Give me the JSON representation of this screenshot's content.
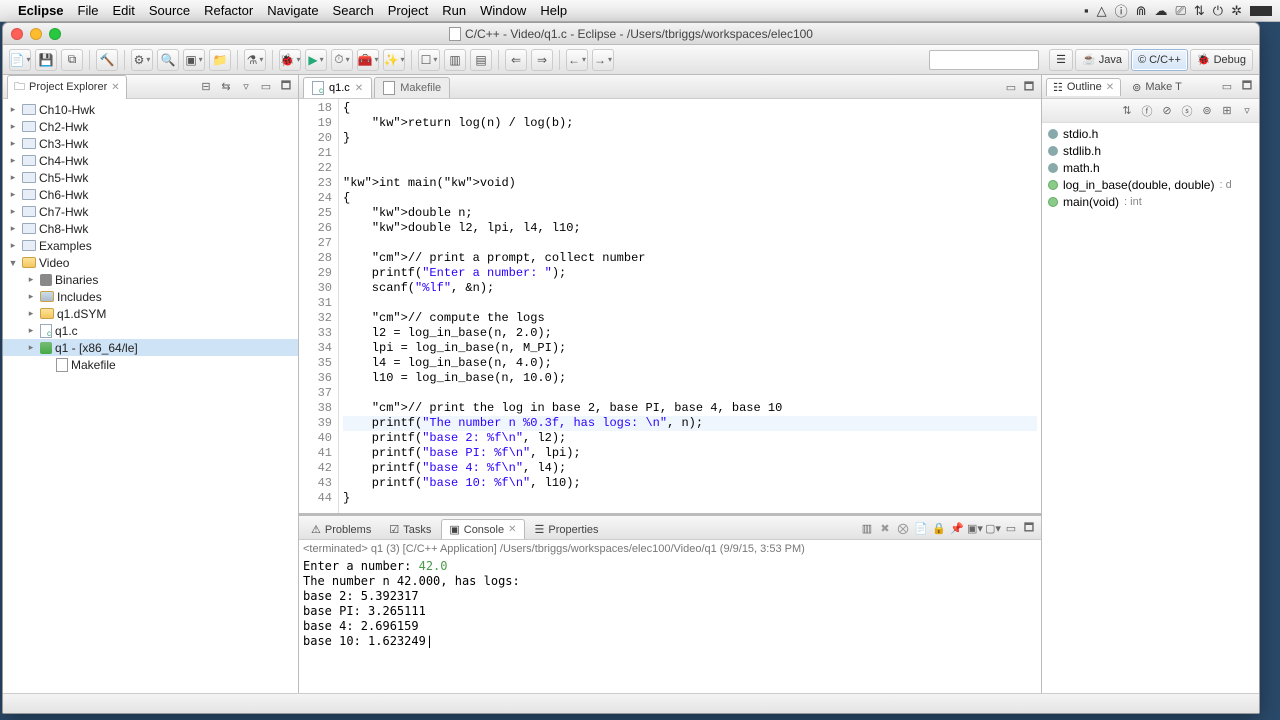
{
  "mac_menu": {
    "app": "Eclipse",
    "items": [
      "File",
      "Edit",
      "Source",
      "Refactor",
      "Navigate",
      "Search",
      "Project",
      "Run",
      "Window",
      "Help"
    ]
  },
  "window": {
    "title": "C/C++ - Video/q1.c - Eclipse - /Users/tbriggs/workspaces/elec100"
  },
  "perspectives": {
    "java": "Java",
    "cpp": "C/C++",
    "debug": "Debug"
  },
  "project_explorer": {
    "title": "Project Explorer",
    "projects": [
      "Ch10-Hwk",
      "Ch2-Hwk",
      "Ch3-Hwk",
      "Ch4-Hwk",
      "Ch5-Hwk",
      "Ch6-Hwk",
      "Ch7-Hwk",
      "Ch8-Hwk",
      "Examples"
    ],
    "open_project": "Video",
    "children": {
      "binaries": "Binaries",
      "includes": "Includes",
      "dsym": "q1.dSYM",
      "src": "q1.c",
      "exe": "q1 - [x86_64/le]",
      "make": "Makefile"
    }
  },
  "editor": {
    "tabs": {
      "active": "q1.c",
      "inactive": "Makefile"
    },
    "gutter_start": 18,
    "lines": [
      "{",
      "    return log(n) / log(b);",
      "}",
      "",
      "",
      "int main(void)",
      "{",
      "    double n;",
      "    double l2, lpi, l4, l10;",
      "",
      "    // print a prompt, collect number",
      "    printf(\"Enter a number: \");",
      "    scanf(\"%lf\", &n);",
      "",
      "    // compute the logs",
      "    l2 = log_in_base(n, 2.0);",
      "    lpi = log_in_base(n, M_PI);",
      "    l4 = log_in_base(n, 4.0);",
      "    l10 = log_in_base(n, 10.0);",
      "",
      "    // print the log in base 2, base PI, base 4, base 10",
      "    printf(\"The number n %0.3f, has logs: \\n\", n);",
      "    printf(\"base 2: %f\\n\", l2);",
      "    printf(\"base PI: %f\\n\", lpi);",
      "    printf(\"base 4: %f\\n\", l4);",
      "    printf(\"base 10: %f\\n\", l10);",
      "}"
    ],
    "highlight_index": 21
  },
  "bottom": {
    "tabs": [
      "Problems",
      "Tasks",
      "Console",
      "Properties"
    ],
    "active": 2,
    "terminated": "<terminated> q1 (3) [C/C++ Application] /Users/tbriggs/workspaces/elec100/Video/q1 (9/9/15, 3:53 PM)",
    "prompt": "Enter a number: ",
    "input": "42.0",
    "out": [
      "The number n 42.000, has logs:",
      "base 2: 5.392317",
      "base PI: 3.265111",
      "base 4: 2.696159",
      "base 10: 1.623249"
    ]
  },
  "outline": {
    "title": "Outline",
    "other_tab": "Make T",
    "items": [
      {
        "kind": "inc",
        "label": "stdio.h"
      },
      {
        "kind": "inc",
        "label": "stdlib.h"
      },
      {
        "kind": "inc",
        "label": "math.h"
      },
      {
        "kind": "fn",
        "label": "log_in_base(double, double)",
        "type": ": d"
      },
      {
        "kind": "fn",
        "label": "main(void)",
        "type": ": int"
      }
    ]
  }
}
